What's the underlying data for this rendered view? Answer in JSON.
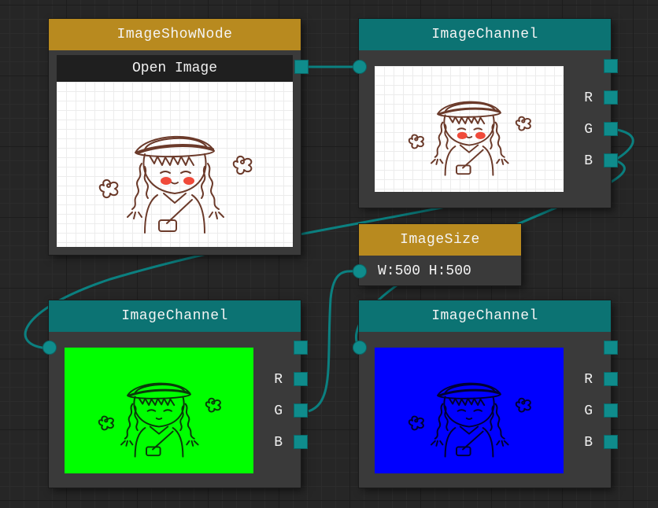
{
  "nodes": {
    "image_show": {
      "title": "ImageShowNode",
      "open_button": "Open Image"
    },
    "channel_top": {
      "title": "ImageChannel",
      "ports": [
        "R",
        "G",
        "B"
      ]
    },
    "image_size": {
      "title": "ImageSize",
      "size_text": "W:500 H:500"
    },
    "channel_left": {
      "title": "ImageChannel",
      "ports": [
        "R",
        "G",
        "B"
      ]
    },
    "channel_right": {
      "title": "ImageChannel",
      "ports": [
        "R",
        "G",
        "B"
      ]
    }
  },
  "colors": {
    "canvas_bg": "#262626",
    "node_bg": "#3a3a3a",
    "title_gold": "#b88a1f",
    "title_teal": "#0c7373",
    "port": "#0f8c8c",
    "wire": "#0b8080",
    "green_channel": "#00ff00",
    "blue_channel": "#0000ff"
  }
}
